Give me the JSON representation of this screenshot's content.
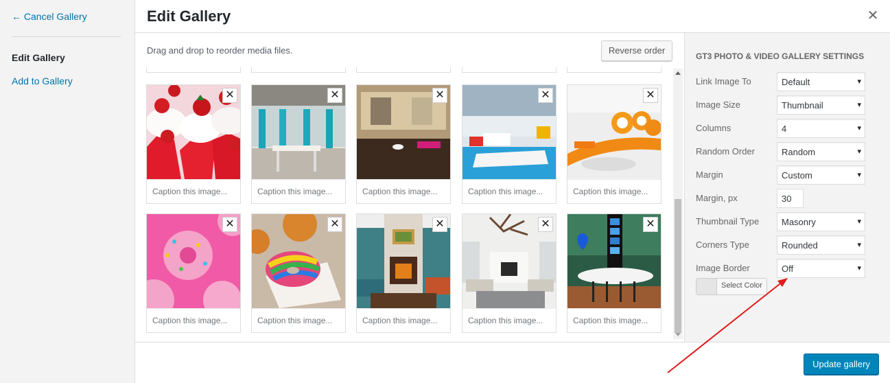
{
  "menu": {
    "cancel_label": "← Cancel Gallery",
    "active_label": "Edit Gallery",
    "add_label": "Add to Gallery"
  },
  "header": {
    "title": "Edit Gallery",
    "close_label": "✕"
  },
  "toolbar": {
    "instructions": "Drag and drop to reorder media files.",
    "reverse_label": "Reverse order"
  },
  "gallery": {
    "remove_label": "✕",
    "caption_placeholder": "Caption this image...",
    "items": [
      {
        "icon": "cupcakes-image"
      },
      {
        "icon": "dining-room-image"
      },
      {
        "icon": "lounge-room-image"
      },
      {
        "icon": "office-google-image"
      },
      {
        "icon": "orange-lounge-image"
      },
      {
        "icon": "pink-donuts-image"
      },
      {
        "icon": "rainbow-donut-image"
      },
      {
        "icon": "living-room-fireplace-image"
      },
      {
        "icon": "white-living-room-image"
      },
      {
        "icon": "bar-interior-image"
      }
    ]
  },
  "settings": {
    "heading": "GT3 Photo & Video Gallery Settings",
    "fields": [
      {
        "label": "Link Image To",
        "value": "Default"
      },
      {
        "label": "Image Size",
        "value": "Thumbnail"
      },
      {
        "label": "Columns",
        "value": "4"
      },
      {
        "label": "Random Order",
        "value": "Random"
      },
      {
        "label": "Margin",
        "value": "Custom"
      },
      {
        "label": "Margin, px",
        "value": "30"
      },
      {
        "label": "Thumbnail Type",
        "value": "Masonry"
      },
      {
        "label": "Corners Type",
        "value": "Rounded"
      },
      {
        "label": "Image Border",
        "value": "Off"
      }
    ],
    "select_color_label": "Select Color",
    "caret": "▾"
  },
  "footer": {
    "update_label": "Update gallery"
  },
  "colors": {
    "accent": "#0085ba",
    "link": "#0073aa",
    "annotation_arrow": "#e21a1a"
  }
}
